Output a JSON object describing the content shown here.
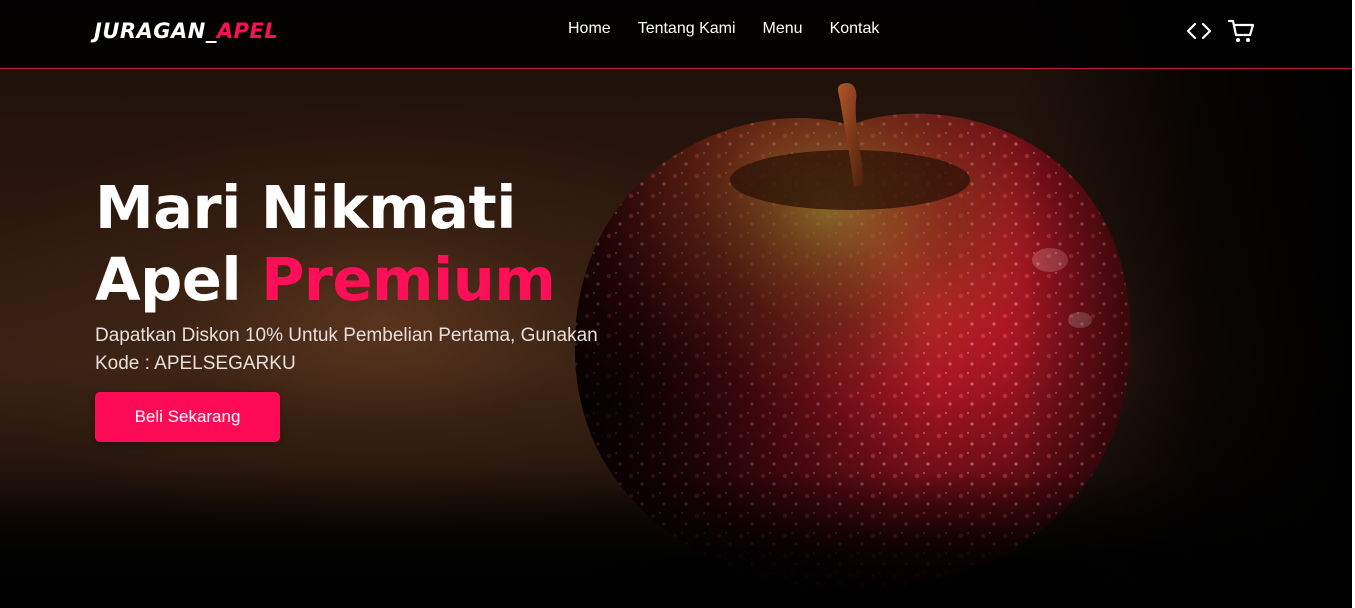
{
  "brand": {
    "name_main": "JURAGAN_",
    "name_accent": "APEL"
  },
  "nav": {
    "links": [
      "Home",
      "Tentang Kami",
      "Menu",
      "Kontak"
    ],
    "icons": [
      "code-icon",
      "shopping-cart-icon"
    ]
  },
  "hero": {
    "title_line1": "Mari Nikmati",
    "title_line2_main": "Apel ",
    "title_line2_accent": "Premium",
    "subtitle": "Dapatkan Diskon 10% Untuk Pembelian Pertama, Gunakan Kode : APELSEGARKU",
    "cta_label": "Beli Sekarang"
  },
  "colors": {
    "accent": "#ff0f57",
    "navbar_bg": "#000000",
    "text": "#ffffff"
  }
}
